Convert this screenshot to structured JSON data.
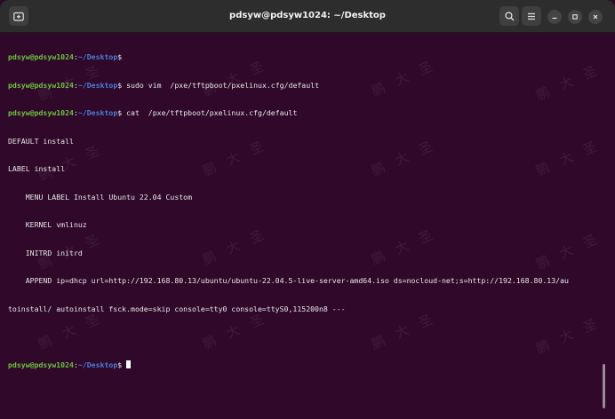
{
  "window": {
    "title": "pdsyw@pdsyw1024: ~/Desktop"
  },
  "titlebar_icons": {
    "new_tab": "terminal-tab-icon",
    "search": "search-icon",
    "menu": "hamburger-menu-icon",
    "minimize": "minimize-icon",
    "maximize": "maximize-icon",
    "close": "close-icon"
  },
  "terminal": {
    "prompt_user": "pdsyw@pdsyw1024",
    "prompt_sep": ":",
    "prompt_path": "~/Desktop",
    "prompt_end": "$",
    "cmd1": "",
    "cmd2": " sudo vim  /pxe/tftpboot/pxelinux.cfg/default",
    "cmd3": " cat  /pxe/tftpboot/pxelinux.cfg/default",
    "output": [
      "DEFAULT install",
      "LABEL install",
      "    MENU LABEL Install Ubuntu 22.04 Custom",
      "    KERNEL vmlinuz",
      "    INITRD initrd",
      "    APPEND ip=dhcp url=http://192.168.80.13/ubuntu/ubuntu-22.04.5-live-server-amd64.iso ds=nocloud-net;s=http://192.168.80.13/au",
      "toinstall/ autoinstall fsck.mode=skip console=tty0 console=ttyS0,115200n8 ---"
    ],
    "cmd4": " "
  },
  "watermark": {
    "text": "鹏大圣"
  },
  "colors": {
    "terminal_bg": "#30092a",
    "titlebar_bg": "#2d2d2d",
    "prompt_user": "#6ac23d",
    "prompt_path": "#4b7bd8"
  }
}
